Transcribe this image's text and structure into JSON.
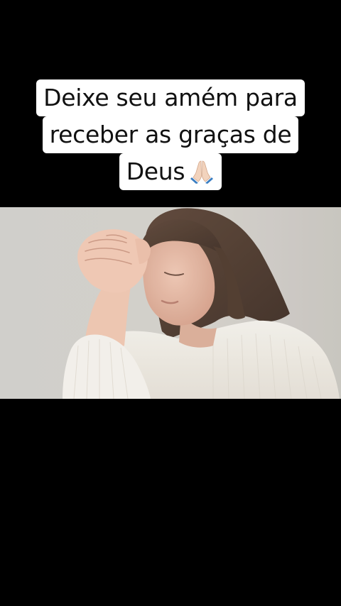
{
  "caption": {
    "lines": [
      "Deixe seu amém para",
      "receber as graças de",
      "Deus"
    ],
    "emoji": "folded-hands-emoji"
  },
  "photo": {
    "subject": "woman-praying-image",
    "colors": {
      "background": "#d8d6d1",
      "sweater": "#ece8e0",
      "hair": "#4a3528",
      "skin": "#e4b8a4"
    }
  },
  "colors": {
    "page_background": "#000000",
    "caption_background": "#ffffff",
    "caption_text": "#111111"
  }
}
